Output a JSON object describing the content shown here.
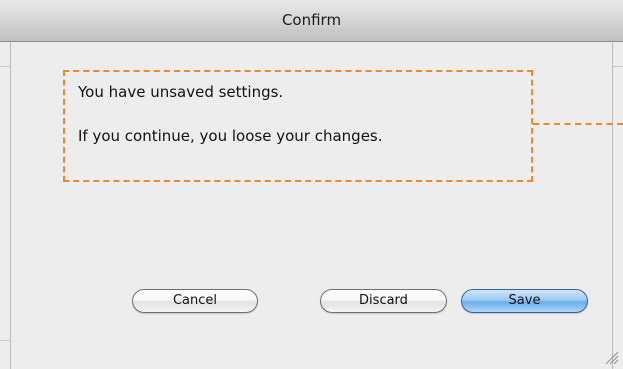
{
  "window": {
    "title": "Confirm"
  },
  "message": {
    "line1": "You have unsaved settings.",
    "line2": "If you continue, you loose your changes."
  },
  "buttons": {
    "cancel": "Cancel",
    "discard": "Discard",
    "save": "Save"
  },
  "colors": {
    "annotation": "#f0882a",
    "default_button": "#6aaeea"
  },
  "icons": {
    "resize": "resize-grip-icon"
  }
}
